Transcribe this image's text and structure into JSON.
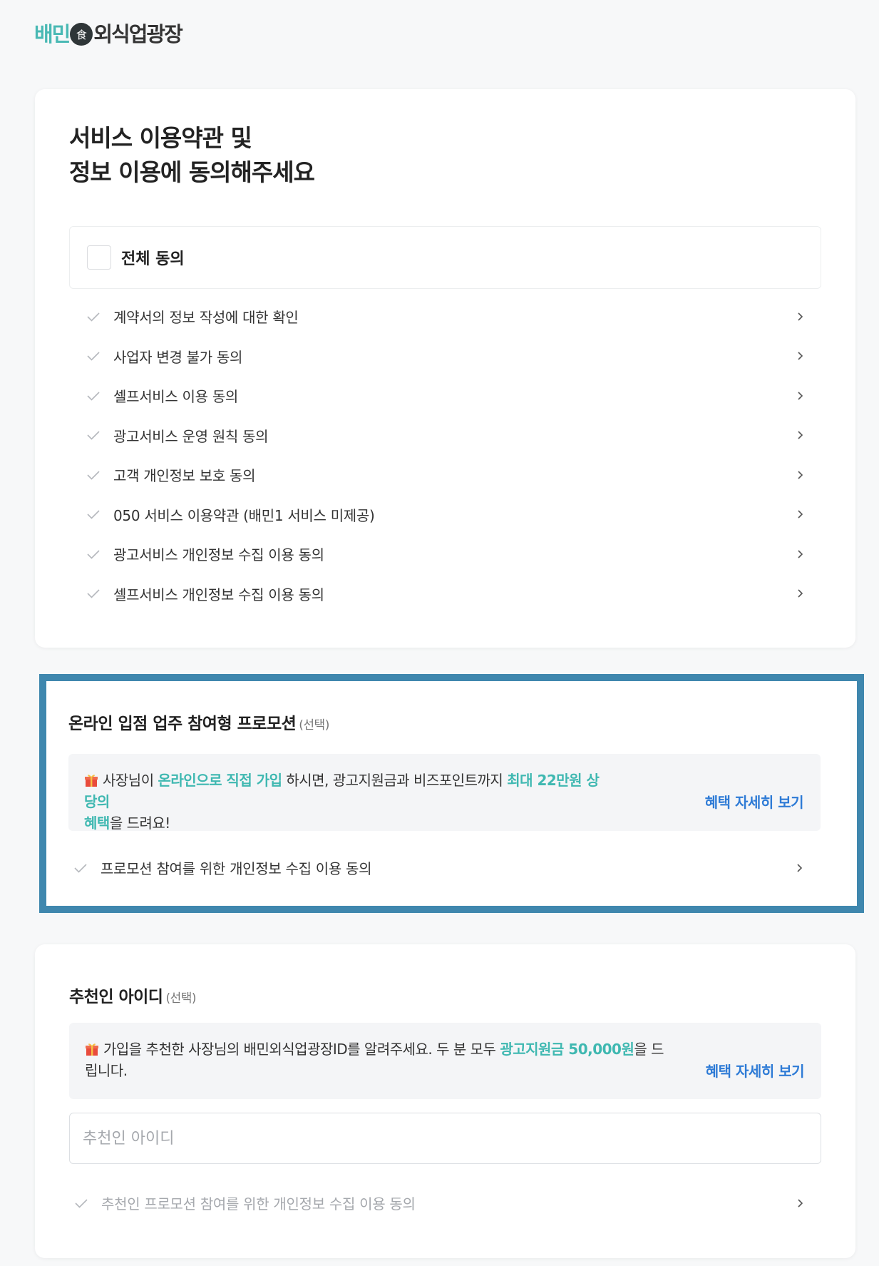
{
  "logo": {
    "part1": "배민",
    "emblem_char": "食",
    "part2": "외식업광장"
  },
  "main": {
    "title_line1": "서비스 이용약관 및",
    "title_line2": "정보 이용에 동의해주세요",
    "all_agree_label": "전체 동의",
    "terms": [
      {
        "label": "계약서의 정보 작성에 대한 확인"
      },
      {
        "label": "사업자 변경 불가 동의"
      },
      {
        "label": "셀프서비스 이용 동의"
      },
      {
        "label": "광고서비스 운영 원칙 동의"
      },
      {
        "label": "고객 개인정보 보호 동의"
      },
      {
        "label": "050 서비스 이용약관 (배민1 서비스 미제공)"
      },
      {
        "label": "광고서비스 개인정보 수집 이용 동의"
      },
      {
        "label": "셀프서비스 개인정보 수집 이용 동의"
      }
    ]
  },
  "promotion": {
    "title": "온라인 입점 업주 참여형 프로모션",
    "optional": "(선택)",
    "text_a": "사장님이 ",
    "text_b": "온라인으로 직접 가입",
    "text_c": " 하시면, 광고지원금과 비즈포인트까지 ",
    "text_d": "최대 22만원 상당의",
    "text_e": "혜택",
    "text_f": "을 드려요!",
    "detail_link": "혜택 자세히 보기",
    "consent_label": "프로모션 참여를 위한 개인정보 수집 이용 동의"
  },
  "referrer": {
    "title": "추천인 아이디",
    "optional": "(선택)",
    "text_a": "가입을 추천한 사장님의 배민외식업광장ID를 알려주세요. 두 분 모두 ",
    "text_b": "광고지원금 50,000원",
    "text_c": "을 드",
    "text_d": "립니다.",
    "detail_link": "혜택 자세히 보기",
    "input_placeholder": "추천인 아이디",
    "consent_label": "추천인 프로모션 참여를 위한 개인정보 수집 이용 동의"
  },
  "colors": {
    "accent_teal": "#3fb8b1",
    "link_blue": "#2e7bd6",
    "highlight_border": "#3f87ae"
  }
}
